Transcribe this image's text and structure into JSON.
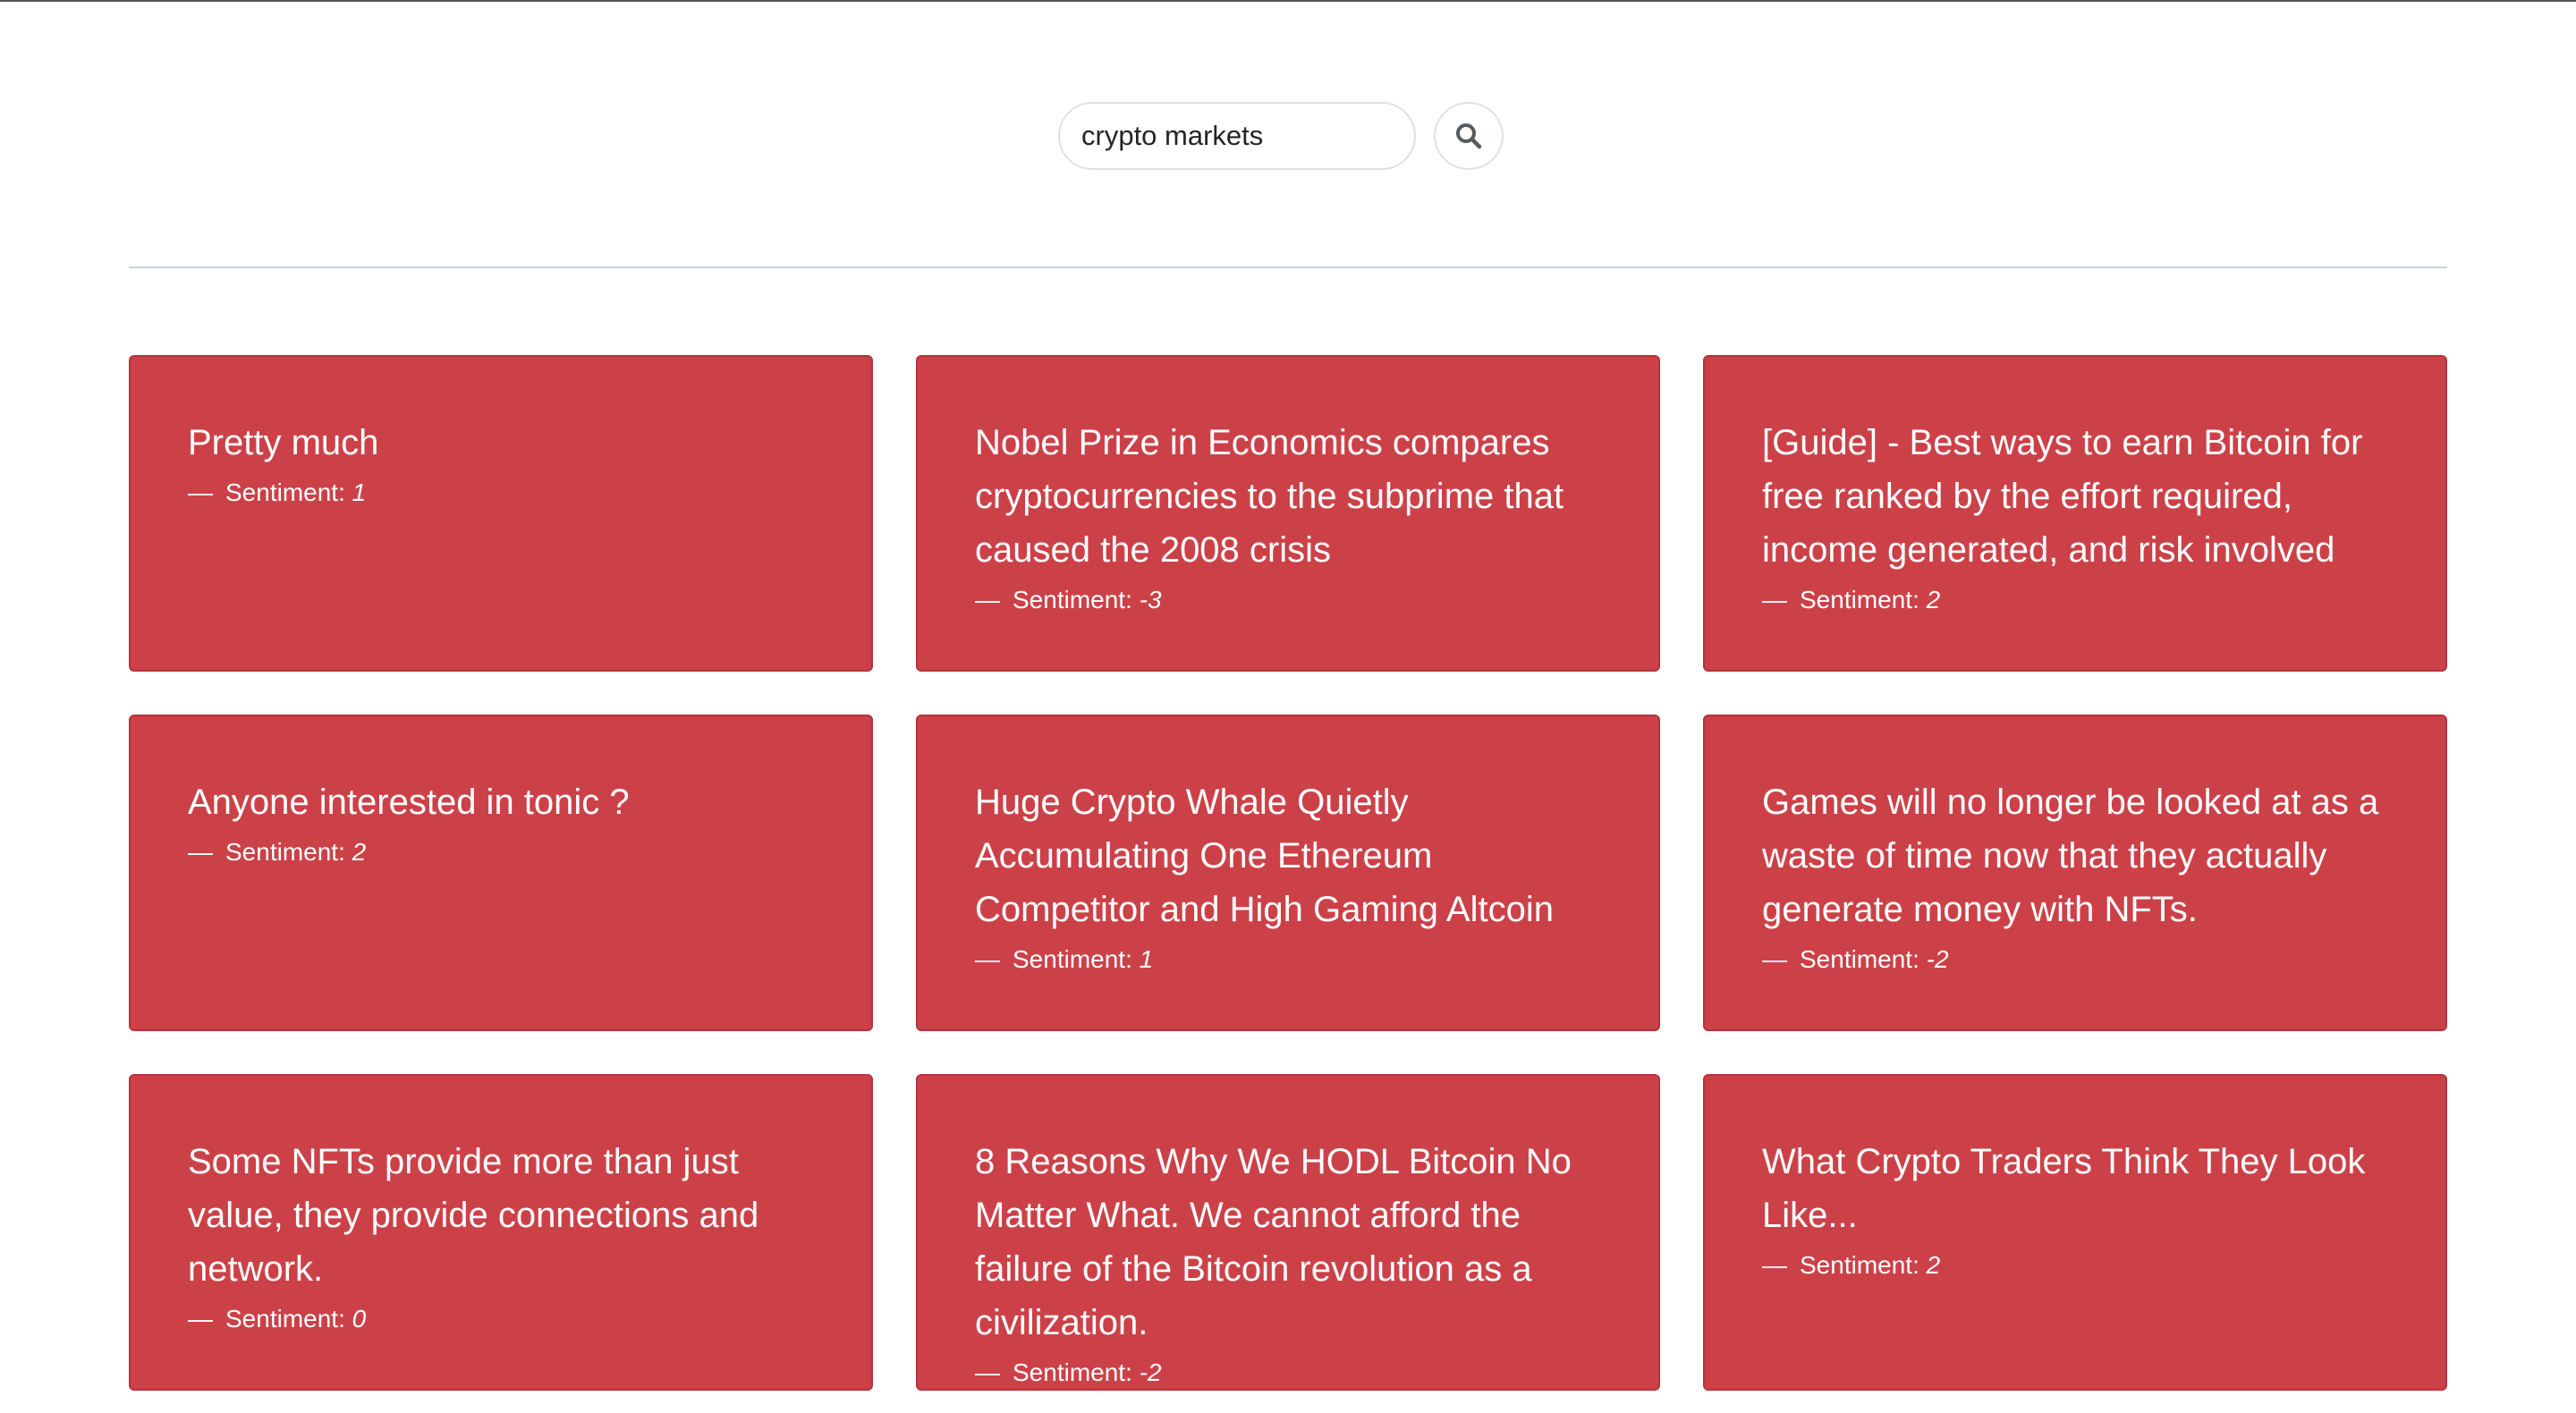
{
  "search": {
    "query": "crypto markets",
    "button_icon": "search-icon"
  },
  "colors": {
    "card_background": "#cc4148",
    "card_text": "#ffffff"
  },
  "results": [
    {
      "title": "Pretty much",
      "sentiment_label": "Sentiment:",
      "sentiment": "1"
    },
    {
      "title": "Nobel Prize in Economics compares cryptocurrencies to the subprime that caused the 2008 crisis",
      "sentiment_label": "Sentiment:",
      "sentiment": "-3"
    },
    {
      "title": "[Guide] - Best ways to earn Bitcoin for free ranked by the effort required, income generated, and risk involved",
      "sentiment_label": "Sentiment:",
      "sentiment": "2"
    },
    {
      "title": "Anyone interested in tonic ?",
      "sentiment_label": "Sentiment:",
      "sentiment": "2"
    },
    {
      "title": "Huge Crypto Whale Quietly Accumulating One Ethereum Competitor and High Gaming Altcoin",
      "sentiment_label": "Sentiment:",
      "sentiment": "1"
    },
    {
      "title": "Games will no longer be looked at as a waste of time now that they actually generate money with NFTs.",
      "sentiment_label": "Sentiment:",
      "sentiment": "-2"
    },
    {
      "title": "Some NFTs provide more than just value, they provide connections and network.",
      "sentiment_label": "Sentiment:",
      "sentiment": "0"
    },
    {
      "title": "8 Reasons Why We HODL Bitcoin No Matter What. We cannot afford the failure of the Bitcoin revolution as a civilization.",
      "sentiment_label": "Sentiment:",
      "sentiment": "-2"
    },
    {
      "title": "What Crypto Traders Think They Look Like...",
      "sentiment_label": "Sentiment:",
      "sentiment": "2"
    }
  ]
}
